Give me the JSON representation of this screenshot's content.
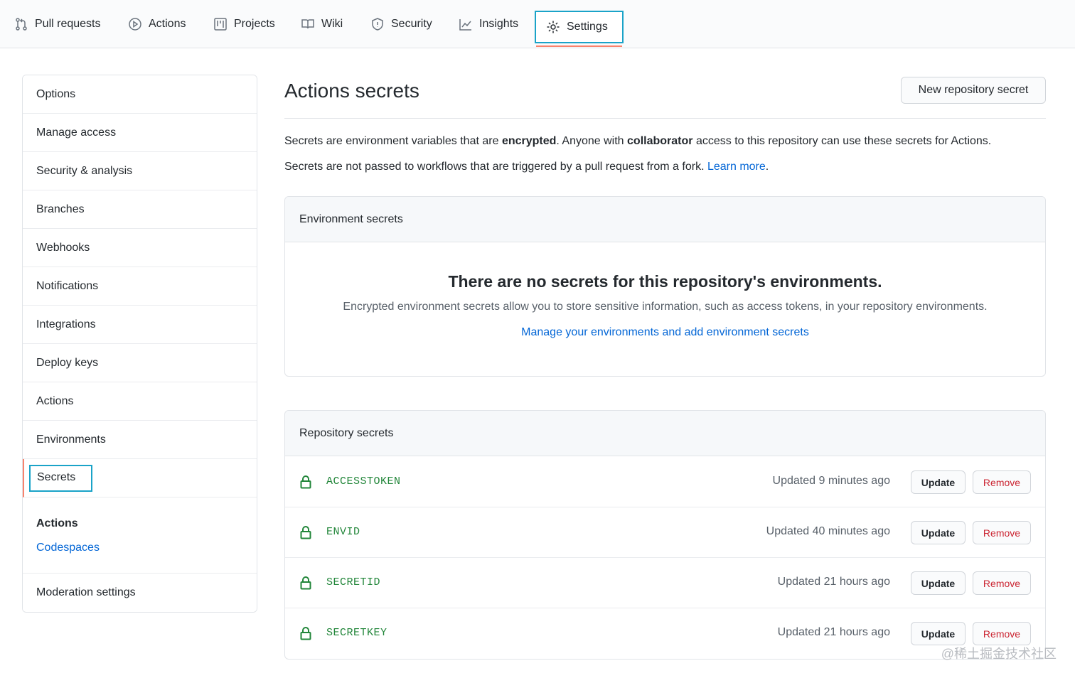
{
  "nav": {
    "tabs": [
      {
        "label": "Pull requests",
        "icon": "pull-request-icon"
      },
      {
        "label": "Actions",
        "icon": "play-icon"
      },
      {
        "label": "Projects",
        "icon": "project-icon"
      },
      {
        "label": "Wiki",
        "icon": "book-icon"
      },
      {
        "label": "Security",
        "icon": "shield-icon"
      },
      {
        "label": "Insights",
        "icon": "graph-icon"
      },
      {
        "label": "Settings",
        "icon": "gear-icon",
        "selected": true
      }
    ]
  },
  "sidebar": {
    "items": [
      {
        "label": "Options"
      },
      {
        "label": "Manage access"
      },
      {
        "label": "Security & analysis"
      },
      {
        "label": "Branches"
      },
      {
        "label": "Webhooks"
      },
      {
        "label": "Notifications"
      },
      {
        "label": "Integrations"
      },
      {
        "label": "Deploy keys"
      },
      {
        "label": "Actions"
      },
      {
        "label": "Environments"
      },
      {
        "label": "Secrets",
        "active": true
      }
    ],
    "group_title": "Actions",
    "group_link": "Codespaces",
    "last_item": "Moderation settings"
  },
  "main": {
    "title": "Actions secrets",
    "new_button": "New repository secret",
    "desc1_a": "Secrets are environment variables that are ",
    "desc1_b": "encrypted",
    "desc1_c": ". Anyone with ",
    "desc1_d": "collaborator",
    "desc1_e": " access to this repository can use these secrets for Actions.",
    "desc2_a": "Secrets are not passed to workflows that are triggered by a pull request from a fork. ",
    "desc2_link": "Learn more",
    "desc2_end": "."
  },
  "env_box": {
    "header": "Environment secrets",
    "blank_title": "There are no secrets for this repository's environments.",
    "blank_text": "Encrypted environment secrets allow you to store sensitive information, such as access tokens, in your repository environments.",
    "blank_link": "Manage your environments and add environment secrets"
  },
  "repo_box": {
    "header": "Repository secrets",
    "update_label": "Update",
    "remove_label": "Remove",
    "secrets": [
      {
        "name": "ACCESSTOKEN",
        "updated": "Updated 9 minutes ago"
      },
      {
        "name": "ENVID",
        "updated": "Updated 40 minutes ago"
      },
      {
        "name": "SECRETID",
        "updated": "Updated 21 hours ago"
      },
      {
        "name": "SECRETKEY",
        "updated": "Updated 21 hours ago"
      }
    ]
  },
  "watermark": "@稀土掘金技术社区",
  "colors": {
    "accent_blue": "#0366d6",
    "secret_green": "#22863a",
    "remove_red": "#cb2431",
    "active_orange": "#f9826c",
    "highlight_cyan": "#1aa3c8"
  }
}
